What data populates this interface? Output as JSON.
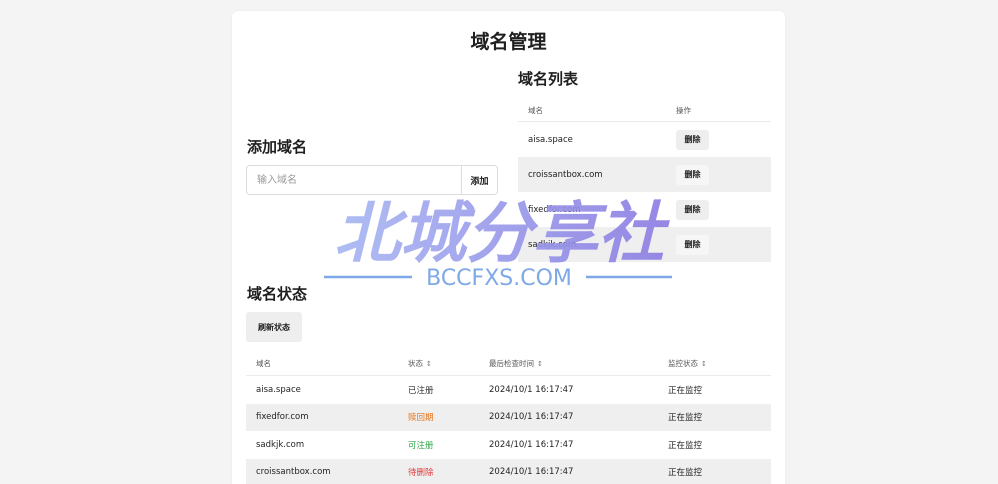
{
  "page": {
    "title": "域名管理"
  },
  "add_section": {
    "title": "添加域名",
    "input_placeholder": "输入域名",
    "add_label": "添加"
  },
  "list_section": {
    "title": "域名列表",
    "headers": [
      "域名",
      "操作"
    ],
    "rows": [
      {
        "domain": "aisa.space",
        "action": "删除"
      },
      {
        "domain": "croissantbox.com",
        "action": "删除"
      },
      {
        "domain": "fixedfor.com",
        "action": "删除"
      },
      {
        "domain": "sadkjk.com",
        "action": "删除"
      }
    ]
  },
  "status_section": {
    "title": "域名状态",
    "refresh_label": "刷新状态",
    "headers": [
      "域名",
      "状态",
      "最后检查时间",
      "监控状态"
    ],
    "sort_glyph": "↕",
    "rows": [
      {
        "domain": "aisa.space",
        "status": "已注册",
        "status_color": "#333333",
        "checked": "2024/10/1 16:17:47",
        "monitor": "正在监控"
      },
      {
        "domain": "fixedfor.com",
        "status": "赎回期",
        "status_color": "#e8741b",
        "checked": "2024/10/1 16:17:47",
        "monitor": "正在监控"
      },
      {
        "domain": "sadkjk.com",
        "status": "可注册",
        "status_color": "#2ea84a",
        "checked": "2024/10/1 16:17:47",
        "monitor": "正在监控"
      },
      {
        "domain": "croissantbox.com",
        "status": "待删除",
        "status_color": "#e03b3b",
        "checked": "2024/10/1 16:17:47",
        "monitor": "正在监控"
      }
    ]
  },
  "watermark": {
    "main": "北城分享社",
    "sub": "BCCFXS.COM",
    "color_main_start": "#a9b8f2",
    "color_main_end": "#8d7ee3",
    "color_sub": "#7fa8e6"
  }
}
